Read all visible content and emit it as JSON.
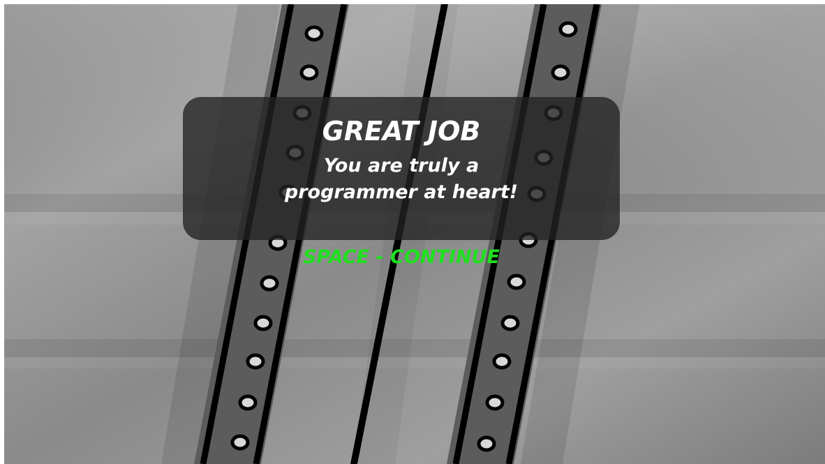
{
  "message": {
    "title": "GREAT JOB",
    "subtitle_line1": "You are truly a",
    "subtitle_line2": "programmer at heart!"
  },
  "prompt": {
    "continue": "SPACE - CONTINUE",
    "color": "#20e020"
  }
}
